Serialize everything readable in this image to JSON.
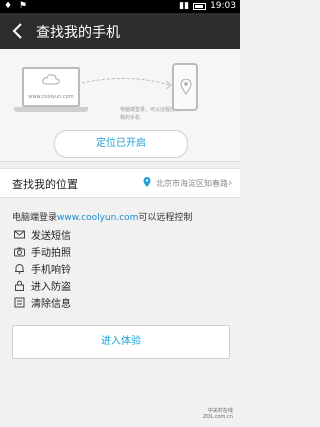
{
  "status_bar": {
    "time": "19:03",
    "left_icons": "♦ ⚑"
  },
  "app_bar": {
    "title": "查找我的手机"
  },
  "hero": {
    "url_text": "www.coolyun.com",
    "note": "电脑端登录，可以远程控制我的手机",
    "locate_button": "定位已开启"
  },
  "location_row": {
    "label": "查找我的位置",
    "value": "北京市海淀区知春路1…"
  },
  "intro": {
    "prefix": "电脑端登录",
    "link": "www.coolyun.com",
    "suffix": "可以远程控制"
  },
  "features": [
    {
      "label": "发送短信",
      "icon": "envelope-icon"
    },
    {
      "label": "手动拍照",
      "icon": "camera-icon"
    },
    {
      "label": "手机响铃",
      "icon": "bell-icon"
    },
    {
      "label": "进入防盗",
      "icon": "lock-icon"
    },
    {
      "label": "清除信息",
      "icon": "trash-icon"
    }
  ],
  "try_button": "进入体验",
  "watermark": {
    "line1": "中关村在线",
    "line2": "ZOL.com.cn"
  },
  "colors": {
    "accent": "#1aa2d6",
    "appbar": "#2d2d2d",
    "background": "#f1f1f1"
  }
}
